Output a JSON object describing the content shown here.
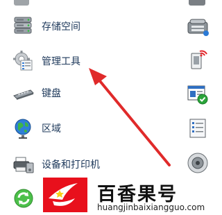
{
  "control_panel_items": [
    {
      "label": "存储空间",
      "icon": "storage-drives-icon"
    },
    {
      "label": "管理工具",
      "icon": "administrative-tools-icon"
    },
    {
      "label": "键盘",
      "icon": "keyboard-icon"
    },
    {
      "label": "区域",
      "icon": "region-globe-icon"
    },
    {
      "label": "设备和打印机",
      "icon": "devices-printers-icon"
    },
    {
      "label": "",
      "icon": "sync-center-icon"
    }
  ],
  "right_column_icons": [
    "phone-modem-icon",
    "wifi-device-icon",
    "security-check-icon",
    "checklist-icon",
    "speaker-icon"
  ],
  "annotation": {
    "arrow_color": "#e02a2a"
  },
  "watermark": {
    "brand_text": "百香果号",
    "url_text": "huangjinbaixiangguo.com",
    "logo_color": "#e8101c"
  },
  "colors": {
    "label_text": "#1e395b",
    "background": "#ffffff"
  }
}
